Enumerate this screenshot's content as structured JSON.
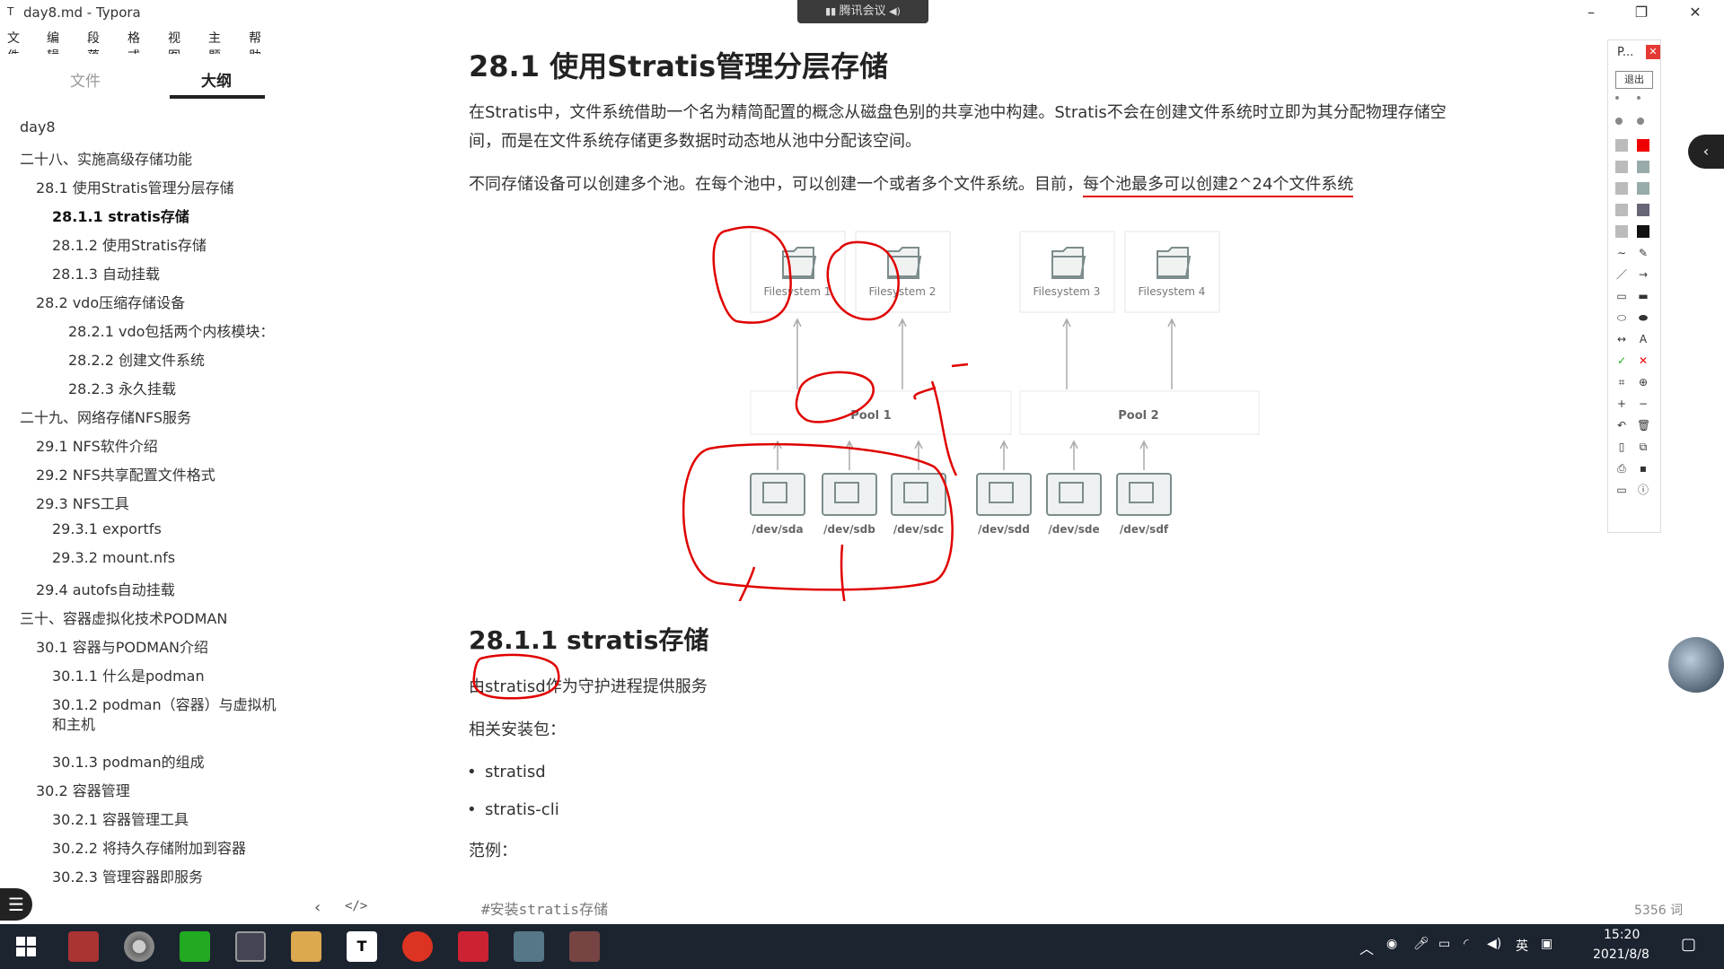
{
  "window": {
    "icon": "T",
    "title": "day8.md - Typora",
    "minimize": "–",
    "maximize": "❐",
    "close": "✕"
  },
  "menu": [
    "文件",
    "编辑",
    "段落",
    "格式",
    "视图",
    "主题",
    "帮助"
  ],
  "meeting_badge": "腾讯会议",
  "sidebar": {
    "tab_files": "文件",
    "tab_outline": "大纲",
    "items": [
      {
        "label": "day8",
        "active": false
      },
      {
        "label": "二十八、实施高级存储功能",
        "active": false
      },
      {
        "label": "28.1 使用Stratis管理分层存储",
        "active": false
      },
      {
        "label": "28.1.1 stratis存储",
        "active": true
      },
      {
        "label": "28.1.2 使用Stratis存储",
        "active": false
      },
      {
        "label": "28.1.3 自动挂载",
        "active": false
      },
      {
        "label": "28.2 vdo压缩存储设备",
        "active": false
      },
      {
        "label": "28.2.1 vdo包括两个内核模块：",
        "active": false
      },
      {
        "label": "28.2.2 创建文件系统",
        "active": false
      },
      {
        "label": "28.2.3 永久挂载",
        "active": false
      },
      {
        "label": "二十九、网络存储NFS服务",
        "active": false
      },
      {
        "label": "29.1 NFS软件介绍",
        "active": false
      },
      {
        "label": "29.2 NFS共享配置文件格式",
        "active": false
      },
      {
        "label": "29.3 NFS工具",
        "active": false
      },
      {
        "label": "29.3.1 exportfs",
        "active": false
      },
      {
        "label": "29.3.2 mount.nfs",
        "active": false
      },
      {
        "label": "29.4 autofs自动挂载",
        "active": false
      },
      {
        "label": "三十、容器虚拟化技术PODMAN",
        "active": false
      },
      {
        "label": "30.1 容器与PODMAN介绍",
        "active": false
      },
      {
        "label": "30.1.1 什么是podman",
        "active": false
      },
      {
        "label": "30.1.2 podman（容器）与虚拟机",
        "active": false
      },
      {
        "label": "和主机",
        "active": false
      },
      {
        "label": "30.1.3 podman的组成",
        "active": false
      },
      {
        "label": "30.2 容器管理",
        "active": false
      },
      {
        "label": "30.2.1 容器管理工具",
        "active": false
      },
      {
        "label": "30.2.2 将持久存储附加到容器",
        "active": false
      },
      {
        "label": "30.2.3 管理容器即服务",
        "active": false
      }
    ],
    "toggle_icon": "☰",
    "footer_back": "‹",
    "footer_code": "</>"
  },
  "doc": {
    "h2": "28.1 使用Stratis管理分层存储",
    "p1_line1": "在Stratis中，文件系统借助一个名为精简配置的概念从磁盘色别的共享池中构建。Stratis不会在创建文件系统时立即为其分配物理存储空",
    "p1_line2": "间，而是在文件系统存储更多数据时动态地从池中分配该空间。",
    "p2_plain": "不同存储设备可以创建多个池。在每个池中，可以创建一个或者多个文件系统。目前，",
    "p2_highlight": "每个池最多可以创建2^24个文件系统",
    "h3": "28.1.1 stratis存储",
    "p3": "由stratisd作为守护进程提供服务",
    "p4": "相关安装包：",
    "bullets": [
      "stratisd",
      "stratis-cli"
    ],
    "p5": "范例：",
    "code_comment": "#安装stratis存储",
    "word_count": "5356 词"
  },
  "diagram": {
    "filesystems": [
      "Filesystem 1",
      "Filesystem 2",
      "Filesystem 3",
      "Filesystem 4"
    ],
    "pools": [
      "Pool 1",
      "Pool 2"
    ],
    "devices": [
      "/dev/sda",
      "/dev/sdb",
      "/dev/sdc",
      "/dev/sdd",
      "/dev/sde",
      "/dev/sdf"
    ],
    "annotation_color": "#e00000"
  },
  "tool_panel": {
    "title": "P...",
    "close": "✕",
    "exit": "退出"
  },
  "right_tab_icon": "‹",
  "taskbar": {
    "time": "15:20",
    "date": "2021/8/8",
    "ime": "英"
  }
}
